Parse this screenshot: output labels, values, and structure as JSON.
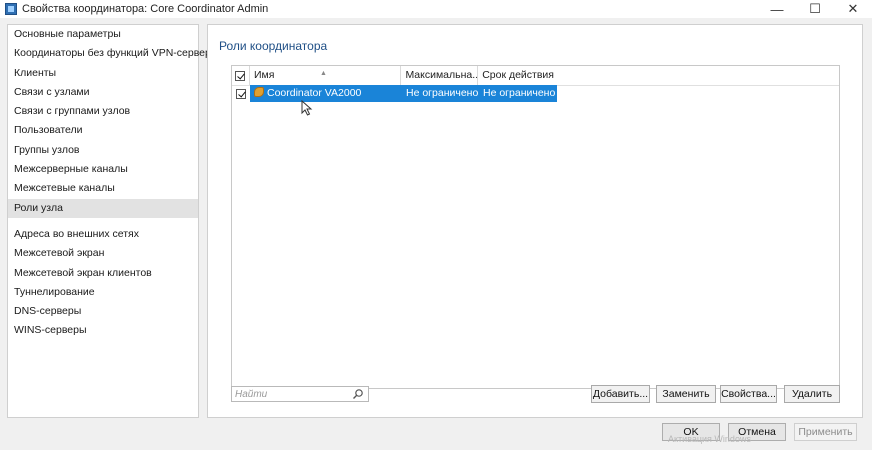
{
  "window": {
    "title": "Свойства координатора: Core Coordinator Admin",
    "controls": {
      "minimize": "—",
      "maximize": "☐",
      "close": "✕"
    }
  },
  "sidebar": {
    "items": [
      {
        "label": "Основные параметры"
      },
      {
        "label": "Координаторы без функций VPN-сервера"
      },
      {
        "label": "Клиенты"
      },
      {
        "label": "Связи с узлами"
      },
      {
        "label": "Связи с группами узлов"
      },
      {
        "label": "Пользователи"
      },
      {
        "label": "Группы узлов"
      },
      {
        "label": "Межсерверные каналы"
      },
      {
        "label": "Межсетевые каналы"
      },
      {
        "label": "Роли узла",
        "selected": true
      },
      {
        "label": "Адреса во внешних сетях"
      },
      {
        "label": "Межсетевой экран"
      },
      {
        "label": "Межсетевой экран клиентов"
      },
      {
        "label": "Туннелирование"
      },
      {
        "label": "DNS-серверы"
      },
      {
        "label": "WINS-серверы"
      }
    ]
  },
  "main": {
    "section_title": "Роли координатора",
    "grid": {
      "columns": [
        "Имя",
        "Максимальна...",
        "Срок действия"
      ],
      "rows": [
        {
          "checked": true,
          "name": "Coordinator VA2000",
          "max": "Не ограничено",
          "term": "Не ограничено",
          "icon": "role-icon"
        }
      ]
    },
    "search": {
      "placeholder": "Найти"
    },
    "buttons": {
      "add": "Добавить...",
      "replace": "Заменить",
      "properties": "Свойства...",
      "delete": "Удалить"
    }
  },
  "footer": {
    "ok": "OK",
    "cancel": "Отмена",
    "apply": "Применить",
    "watermark": "Активация Windows"
  },
  "colors": {
    "selection": "#1a84d8",
    "section_title": "#1f4f86"
  }
}
